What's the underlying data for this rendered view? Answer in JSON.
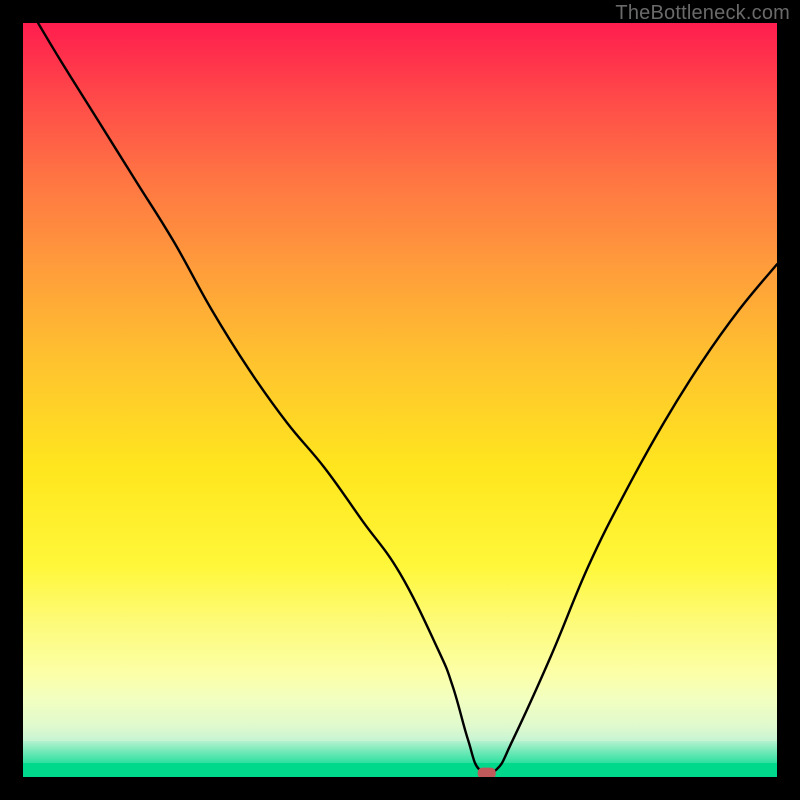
{
  "watermark": {
    "text": "TheBottleneck.com"
  },
  "chart_data": {
    "type": "line",
    "title": "",
    "xlabel": "",
    "ylabel": "",
    "xlim": [
      0,
      100
    ],
    "ylim": [
      0,
      100
    ],
    "grid": false,
    "legend": false,
    "background_gradient_stops": [
      {
        "pct": 0,
        "color": "#ff1d4e"
      },
      {
        "pct": 25,
        "color": "#ff7343"
      },
      {
        "pct": 50,
        "color": "#ffc22f"
      },
      {
        "pct": 72,
        "color": "#fff73a"
      },
      {
        "pct": 88,
        "color": "#f2ffc0"
      },
      {
        "pct": 96,
        "color": "#6fe9b7"
      },
      {
        "pct": 100,
        "color": "#00d88c"
      }
    ],
    "series": [
      {
        "name": "bottleneck-curve",
        "color": "#000000",
        "x": [
          2,
          5,
          10,
          15,
          20,
          25,
          30,
          35,
          40,
          45,
          50,
          55,
          57,
          59,
          60.5,
          62.8,
          65,
          70,
          75,
          80,
          85,
          90,
          95,
          100
        ],
        "y": [
          100,
          95,
          87,
          79,
          71,
          62,
          54,
          47,
          41,
          34,
          27,
          17,
          12,
          5,
          1,
          1,
          5,
          16,
          28,
          38,
          47,
          55,
          62,
          68
        ]
      }
    ],
    "marker": {
      "name": "optimal-point",
      "x": 61.5,
      "y": 0.5,
      "shape": "rounded-rect",
      "color": "#c05a5a",
      "width_pct": 2.4,
      "height_pct": 1.5
    }
  }
}
